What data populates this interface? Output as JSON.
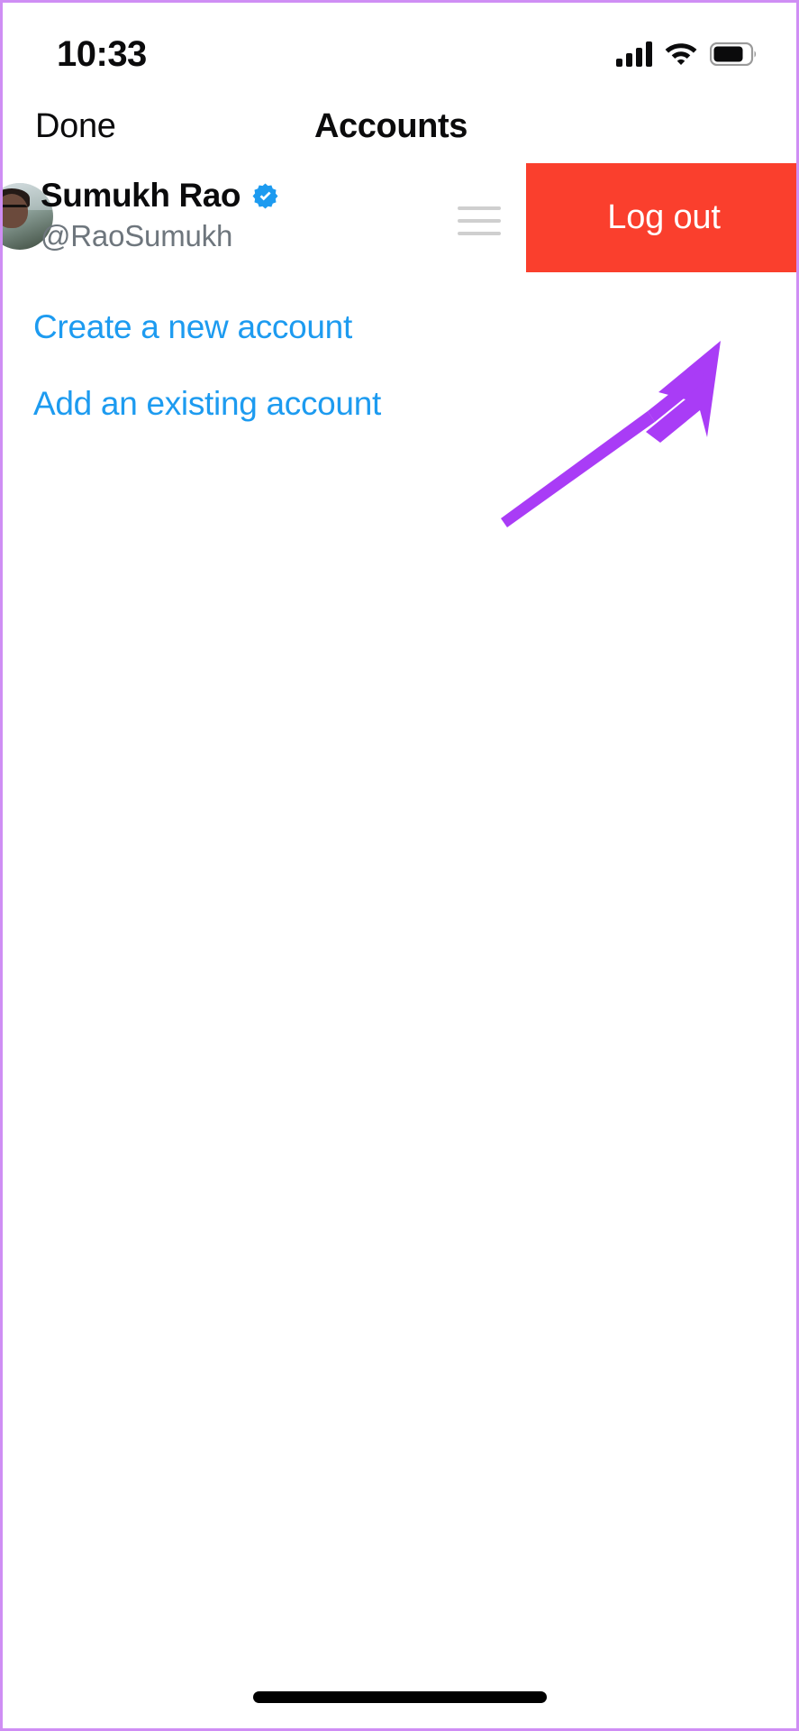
{
  "status_bar": {
    "time": "10:33",
    "signal_icon": "cellular-signal-icon",
    "wifi_icon": "wifi-icon",
    "battery_icon": "battery-icon",
    "battery_level_percent": 80
  },
  "nav": {
    "done_label": "Done",
    "title": "Accounts"
  },
  "account": {
    "display_name": "Sumukh Rao",
    "handle": "@RaoSumukh",
    "verified": true,
    "verified_icon": "verified-badge-icon",
    "avatar_icon": "avatar-photo",
    "reorder_icon": "reorder-grip-icon",
    "logout_label": "Log out"
  },
  "links": [
    {
      "label": "Create a new account",
      "name": "create-new-account-link"
    },
    {
      "label": "Add an existing account",
      "name": "add-existing-account-link"
    }
  ],
  "annotation": {
    "arrow_icon": "arrow-pointing-up-right",
    "target": "Log out"
  },
  "colors": {
    "accent_blue": "#1D9BF0",
    "destructive_red": "#FA3F2D",
    "annotation_purple": "#A93CF6",
    "secondary_text": "#6E767D",
    "primary_text": "#0B0B0C",
    "frame_border": "#CF8EF4",
    "grip_gray": "#CFCFCF"
  }
}
